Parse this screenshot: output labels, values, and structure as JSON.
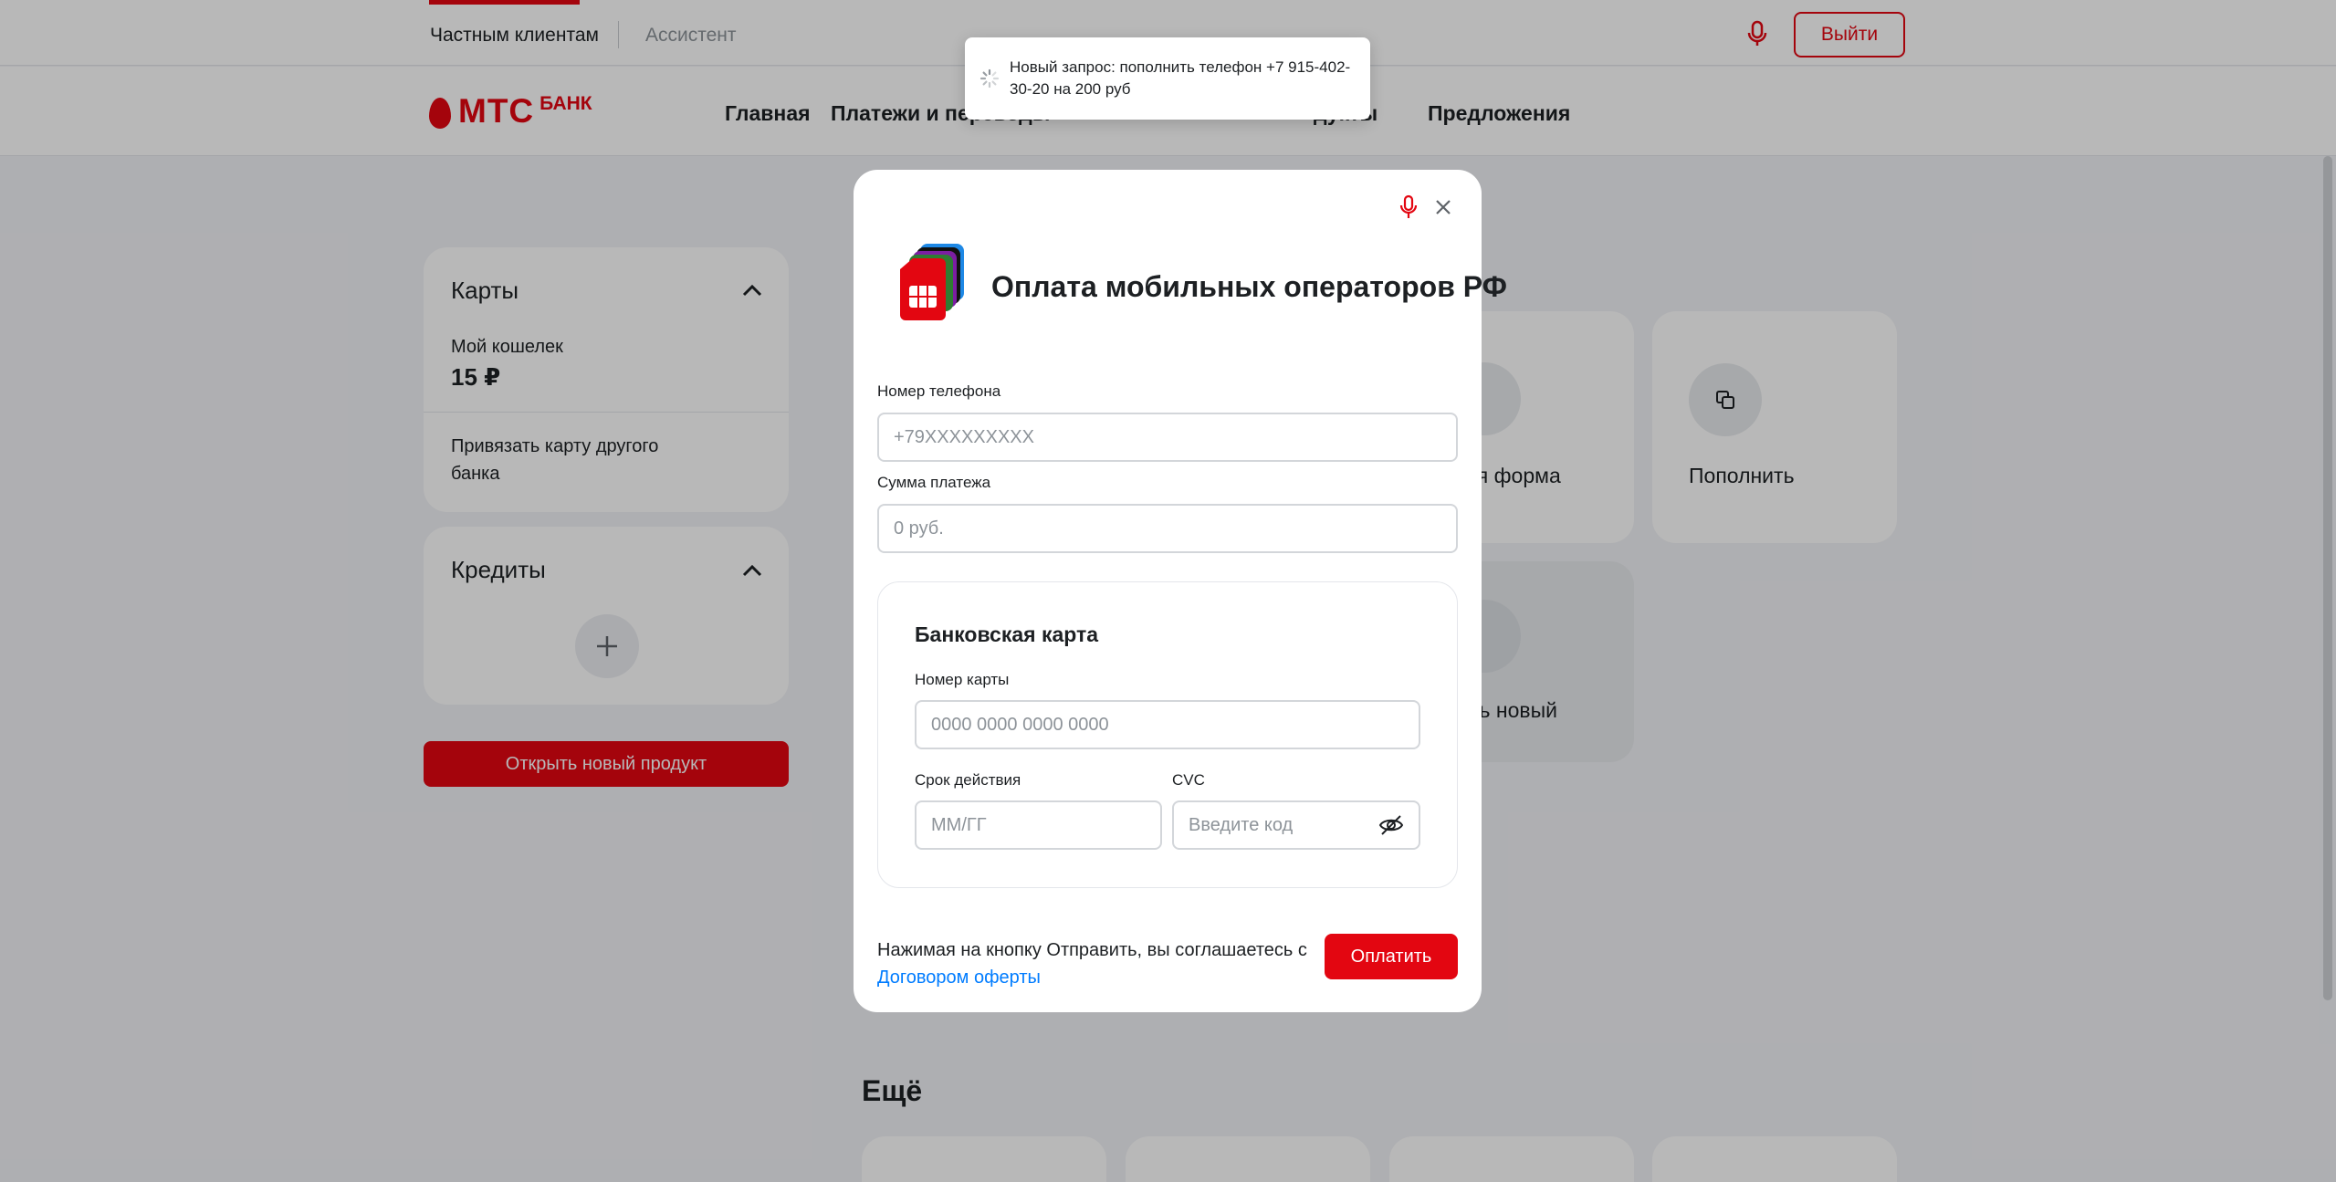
{
  "topbar": {
    "tab_private": "Частным клиентам",
    "tab_assistant": "Ассистент",
    "logout_label": "Выйти"
  },
  "logo": {
    "main": "МТС",
    "sub": "БАНК"
  },
  "nav": {
    "items": [
      "Главная",
      "Платежи и переводы",
      "Предложения"
    ],
    "item_fragment_products": "дукты"
  },
  "sidebar": {
    "cards_title": "Карты",
    "wallet_label": "Мой кошелек",
    "wallet_value": "15 ₽",
    "bind_card_label": "Привязать карту другого банка",
    "credits_title": "Кредиты",
    "open_product_label": "Открыть новый продукт"
  },
  "tiles": {
    "fragment_form": "ая форма",
    "topup_label": "Пополнить",
    "fragment_new": "ть новый"
  },
  "more": {
    "title": "Ещё"
  },
  "toast": {
    "text": "Новый запрос: пополнить телефон +7 915-402-30-20 на 200 руб"
  },
  "modal": {
    "title": "Оплата мобильных операторов РФ",
    "phone_label": "Номер телефона",
    "phone_placeholder": "+79XXXXXXXXX",
    "phone_value": "",
    "amount_label": "Сумма платежа",
    "amount_placeholder": "0 руб.",
    "amount_value": "",
    "bank_card_title": "Банковская карта",
    "card_number_label": "Номер карты",
    "card_number_placeholder": "0000 0000 0000 0000",
    "expiry_label": "Срок действия",
    "expiry_placeholder": "ММ/ГГ",
    "cvc_label": "CVC",
    "cvc_placeholder": "Введите код",
    "consent_text": "Нажимая на кнопку Отправить, вы соглашаетесь с",
    "consent_link": "Договором оферты",
    "pay_label": "Оплатить"
  },
  "colors": {
    "brand_red": "#e30611",
    "link_blue": "#007cff",
    "overlay": "rgba(0,0,0,0.28)"
  },
  "icons": [
    "microphone-icon",
    "close-icon",
    "chevron-up-icon",
    "plus-icon",
    "copy-icon",
    "eye-off-icon",
    "spinner-icon",
    "sim-card-icon"
  ]
}
